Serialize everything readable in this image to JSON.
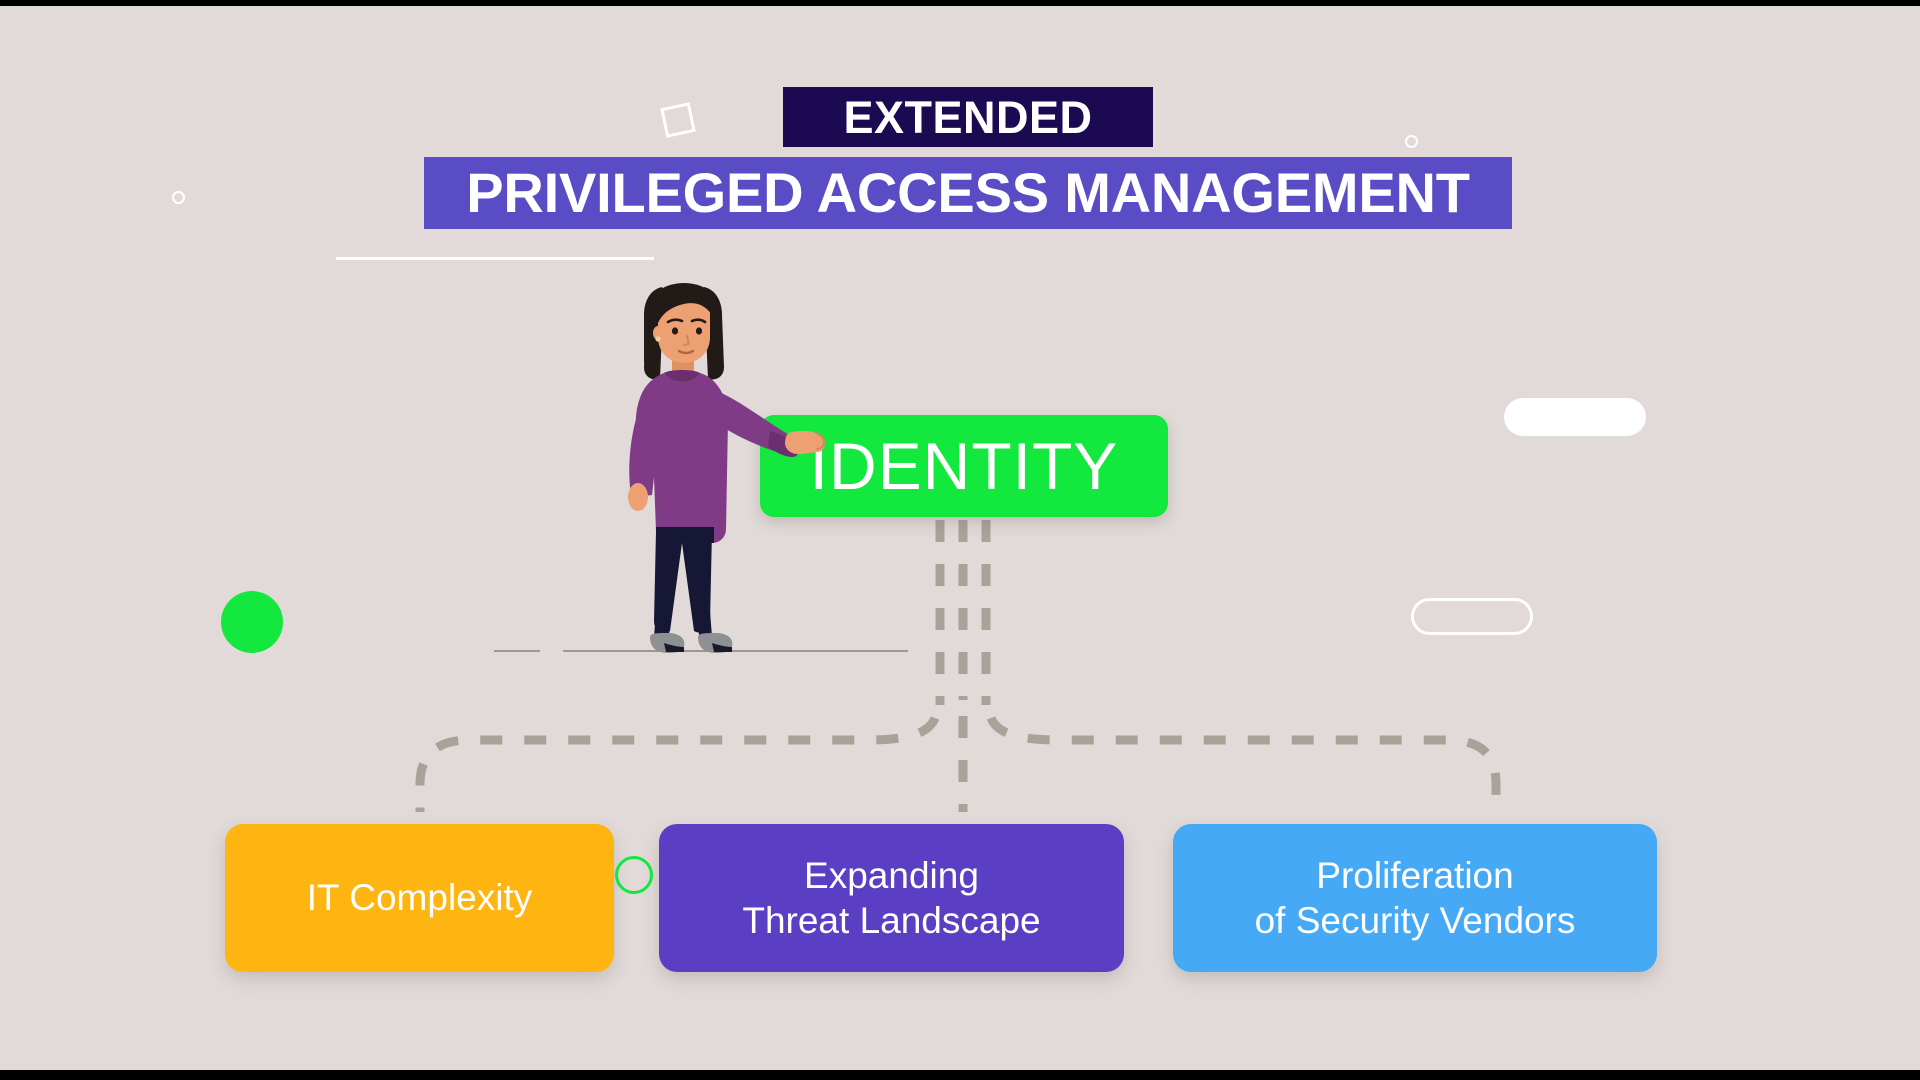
{
  "slide": {
    "title_eyebrow": "EXTENDED",
    "title_main": "PRIVILEGED ACCESS MANAGEMENT",
    "center_node": "IDENTITY",
    "background_color": "#e1dad8"
  },
  "colors": {
    "eyebrow_banner": "#1b0a52",
    "main_banner": "#5a4cc4",
    "identity_green": "#13e83e",
    "card_it_complexity": "#ffb511",
    "card_threat_landscape": "#5a3fc4",
    "card_security_vendors": "#45a9f5",
    "connector_gray": "#a8a298",
    "accent_white": "#ffffff"
  },
  "factors": [
    {
      "id": "it-complexity",
      "label": "IT Complexity",
      "line1": "IT Complexity",
      "line2": "",
      "color": "#ffb511"
    },
    {
      "id": "threat-landscape",
      "label": "Expanding Threat Landscape",
      "line1": "Expanding",
      "line2": "Threat Landscape",
      "color": "#5a3fc4"
    },
    {
      "id": "security-vendors",
      "label": "Proliferation of Security Vendors",
      "line1": "Proliferation",
      "line2": "of Security Vendors",
      "color": "#45a9f5"
    }
  ],
  "decorations": [
    {
      "name": "tilted-square-outline",
      "shape": "square-outline"
    },
    {
      "name": "small-circle-outline-left",
      "shape": "circle-outline"
    },
    {
      "name": "small-circle-outline-right",
      "shape": "circle-outline"
    },
    {
      "name": "white-underline",
      "shape": "line"
    },
    {
      "name": "filled-pill",
      "shape": "pill-filled"
    },
    {
      "name": "outlined-pill",
      "shape": "pill-outline"
    },
    {
      "name": "green-dot",
      "shape": "circle-filled"
    },
    {
      "name": "green-ring",
      "shape": "circle-outline"
    }
  ],
  "illustration": {
    "name": "woman-pushing-identity-block",
    "hair_color": "#221a17",
    "skin_color": "#eda172",
    "top_color": "#7f3b85",
    "pants_color": "#151735",
    "shoe_color": "#8e9193"
  }
}
